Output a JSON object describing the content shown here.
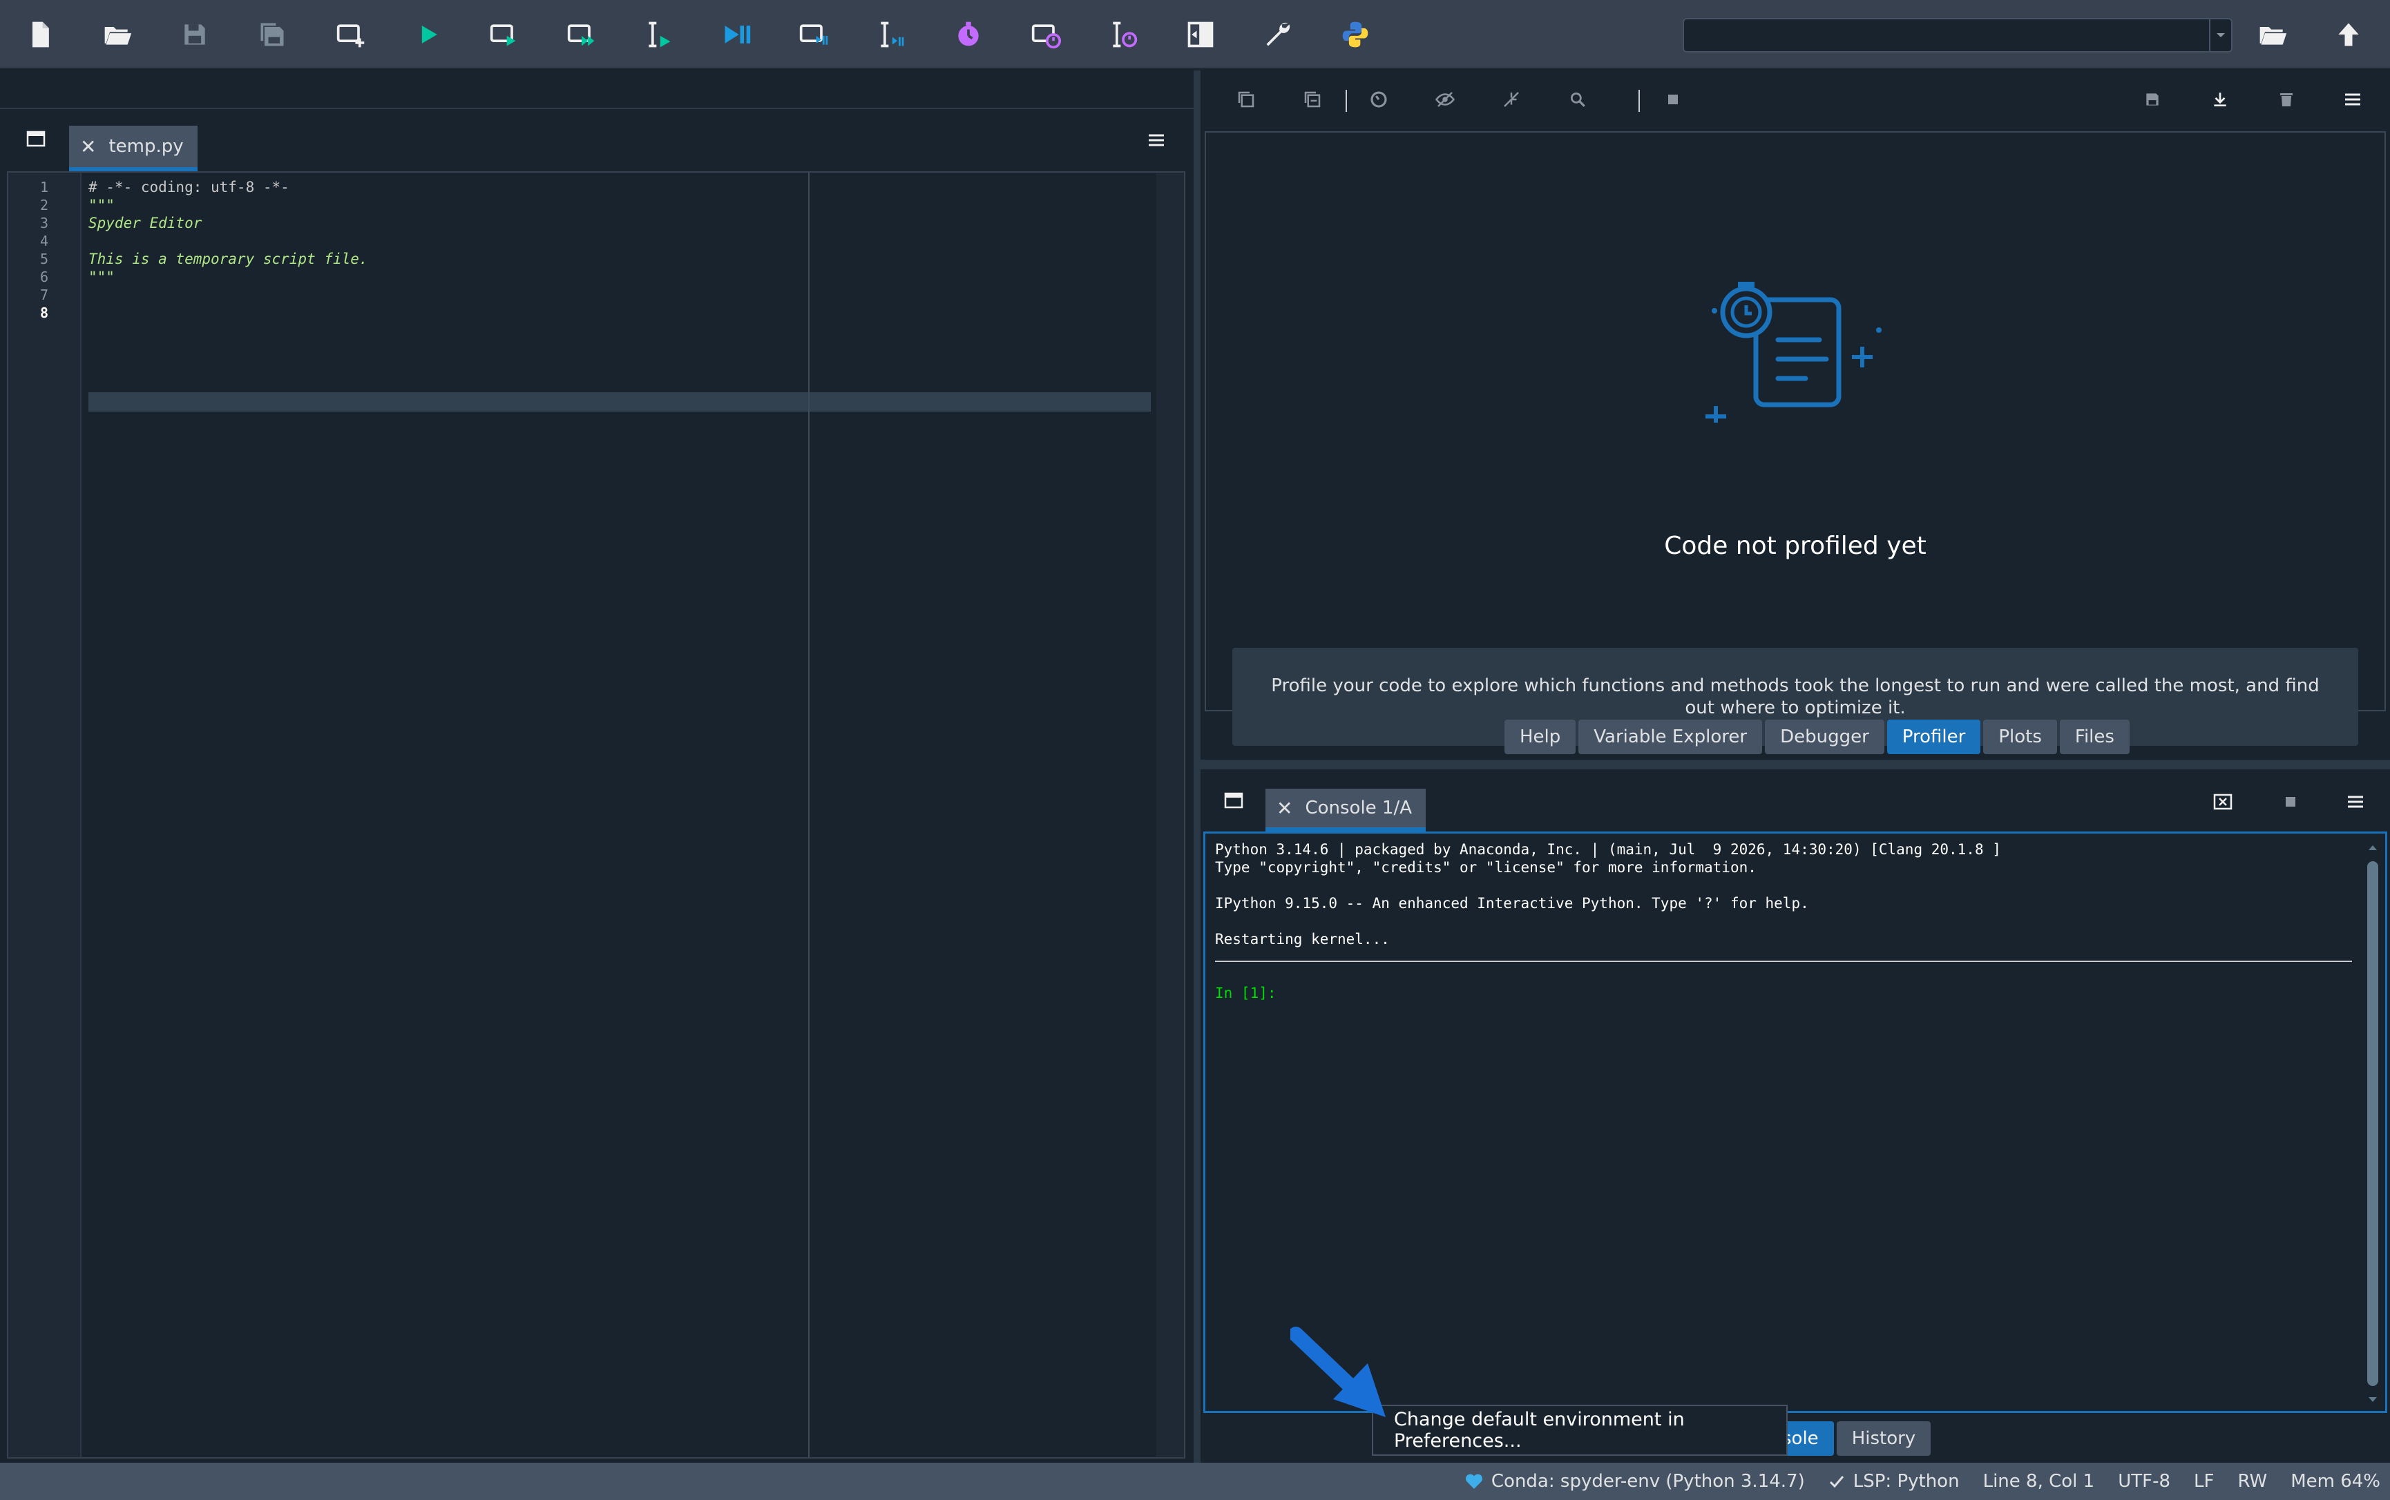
{
  "toolbar": {
    "buttons": [
      {
        "name": "new-file-icon",
        "interactive": true
      },
      {
        "name": "open-file-icon",
        "interactive": true
      },
      {
        "name": "save-file-icon",
        "interactive": true
      },
      {
        "name": "save-all-icon",
        "interactive": true
      },
      {
        "name": "new-cell-icon",
        "interactive": true
      },
      {
        "name": "run-file-icon",
        "interactive": true
      },
      {
        "name": "run-cell-icon",
        "interactive": true
      },
      {
        "name": "run-cell-advance-icon",
        "interactive": true
      },
      {
        "name": "run-selection-icon",
        "interactive": true
      },
      {
        "name": "debug-file-icon",
        "interactive": true
      },
      {
        "name": "debug-cell-icon",
        "interactive": true
      },
      {
        "name": "debug-selection-icon",
        "interactive": true
      },
      {
        "name": "profile-file-icon",
        "interactive": true
      },
      {
        "name": "profile-cell-icon",
        "interactive": true
      },
      {
        "name": "profile-selection-icon",
        "interactive": true
      },
      {
        "name": "maximize-pane-icon",
        "interactive": true
      },
      {
        "name": "preferences-wrench-icon",
        "interactive": true
      },
      {
        "name": "python-path-icon",
        "interactive": true
      }
    ],
    "working_directory": "",
    "browse_folder_icon": "folder-open-icon",
    "parent_dir_icon": "arrow-up-icon"
  },
  "editor": {
    "tab_label": "temp.py",
    "close_glyph": "✕",
    "current_line": 8,
    "line_numbers": [
      "1",
      "2",
      "3",
      "4",
      "5",
      "6",
      "7",
      "8"
    ],
    "lines": [
      {
        "text": "# -*- coding: utf-8 -*-",
        "kind": "comment"
      },
      {
        "text": "\"\"\"",
        "kind": "str"
      },
      {
        "text": "Spyder Editor",
        "kind": "str"
      },
      {
        "text": "",
        "kind": "str"
      },
      {
        "text": "This is a temporary script file.",
        "kind": "str"
      },
      {
        "text": "\"\"\"",
        "kind": "str"
      },
      {
        "text": "",
        "kind": "plain"
      },
      {
        "text": "",
        "kind": "plain"
      }
    ]
  },
  "profiler": {
    "empty_title": "Code not profiled yet",
    "empty_description": "Profile your code to explore which functions and methods took the longest to run and were called the most, and find out where to optimize it."
  },
  "plugin_tabs": [
    {
      "label": "Help",
      "active": false
    },
    {
      "label": "Variable Explorer",
      "active": false
    },
    {
      "label": "Debugger",
      "active": false
    },
    {
      "label": "Profiler",
      "active": true
    },
    {
      "label": "Plots",
      "active": false
    },
    {
      "label": "Files",
      "active": false
    }
  ],
  "console": {
    "tab_label": "Console 1/A",
    "close_glyph": "✕",
    "lines": [
      "Python 3.14.6 | packaged by Anaconda, Inc. | (main, Jul  9 2026, 14:30:20) [Clang 20.1.8 ]",
      "Type \"copyright\", \"credits\" or \"license\" for more information.",
      "",
      "IPython 9.15.0 -- An enhanced Interactive Python. Type '?' for help.",
      "",
      "Restarting kernel..."
    ],
    "prompt": "In [1]:",
    "bottom_tabs": [
      {
        "label": "sole",
        "active": true
      },
      {
        "label": "History",
        "active": false
      }
    ]
  },
  "tooltip": {
    "text": "Change default environment in Preferences..."
  },
  "statusbar": {
    "env": "Conda: spyder-env (Python 3.14.7)",
    "lsp": "LSP: Python",
    "cursor": "Line 8, Col 1",
    "encoding": "UTF-8",
    "eol": "LF",
    "mode": "RW",
    "memory": "Mem 64%"
  },
  "colors": {
    "accent": "#1a72bb",
    "run_green": "#00c7a0",
    "profile_violet": "#c46bff",
    "prompt_green": "#00dd00",
    "status_heart": "#3daee9"
  }
}
